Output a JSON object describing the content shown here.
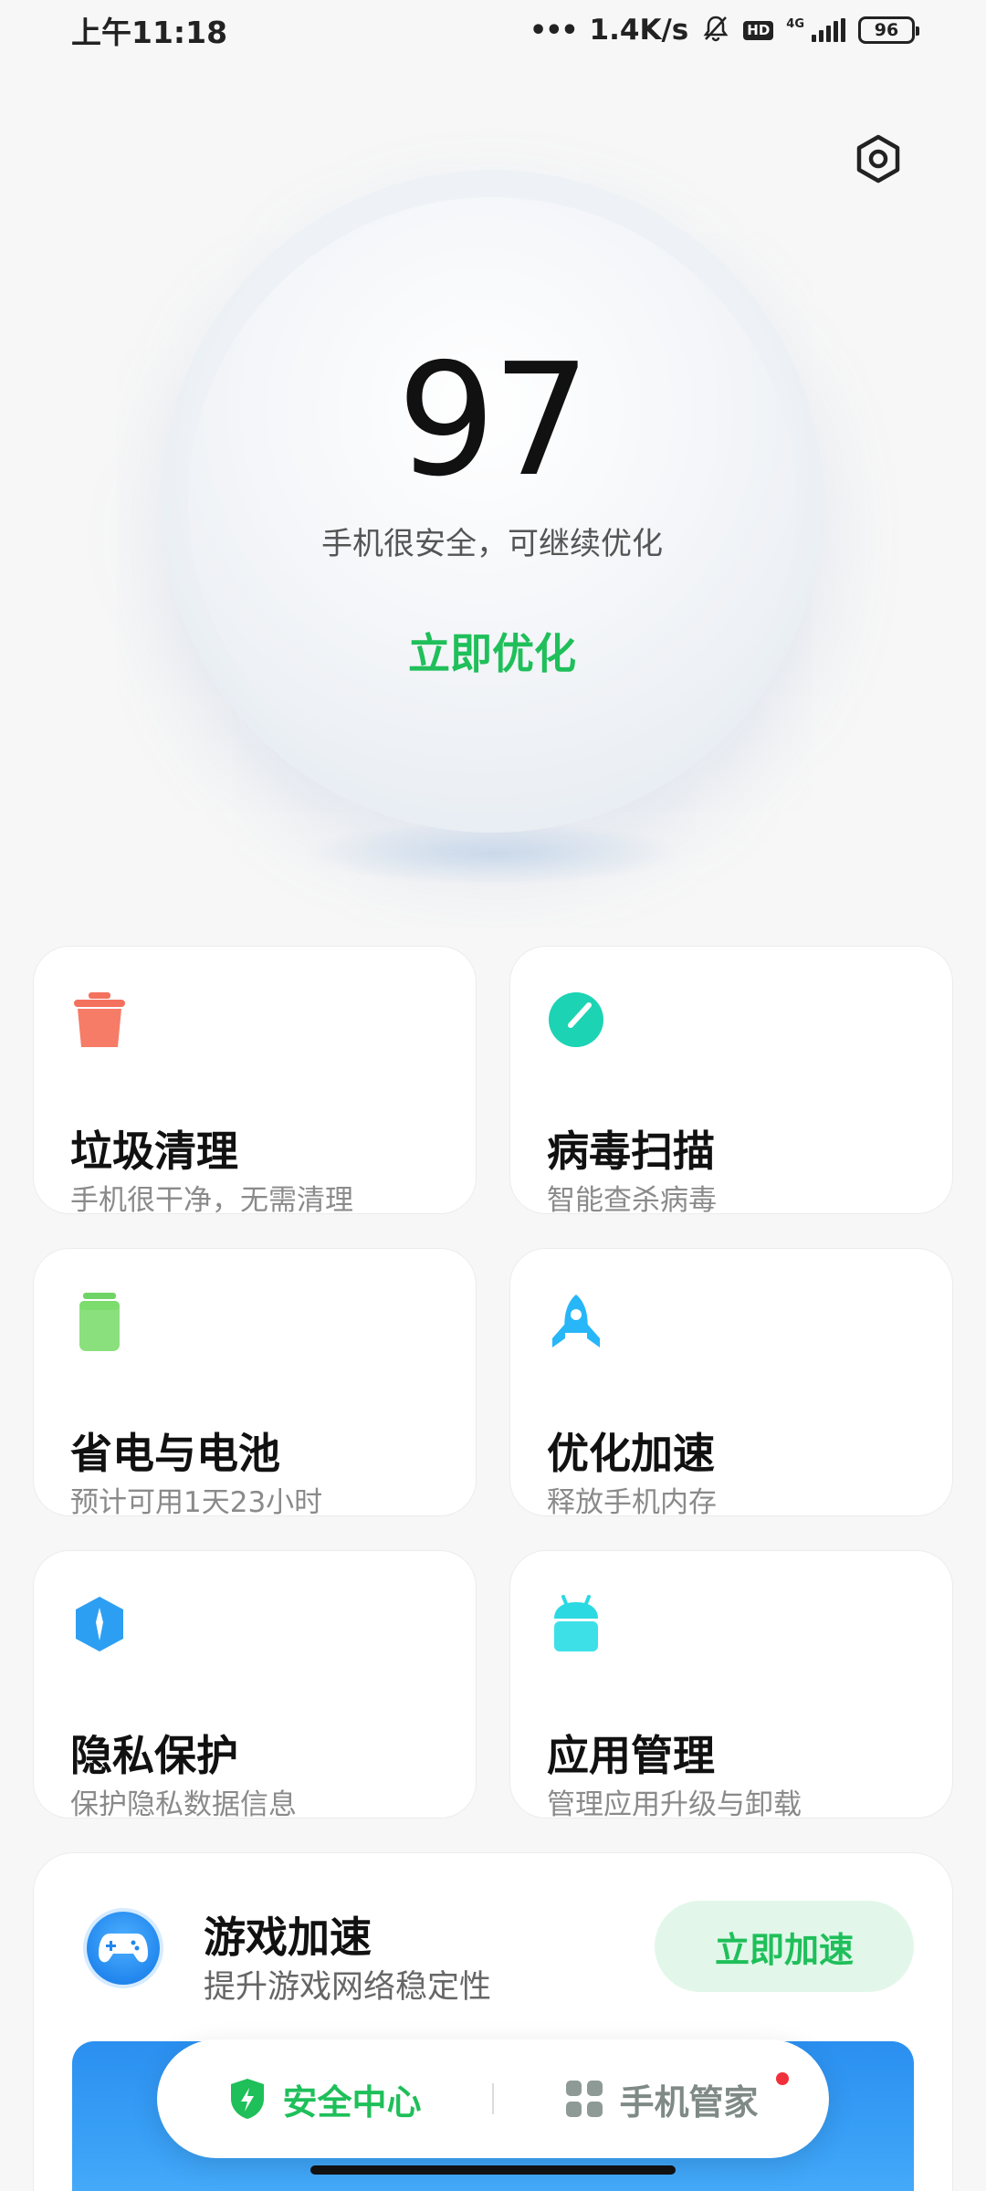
{
  "status_bar": {
    "time": "上午11:18",
    "network_speed": "1.4K/s",
    "hd_label": "HD",
    "network_type": "4G",
    "battery": "96"
  },
  "score": {
    "value": "97",
    "description": "手机很安全，可继续优化",
    "action_label": "立即优化"
  },
  "features": [
    {
      "title": "垃圾清理",
      "subtitle": "手机很干净，无需清理",
      "icon": "trash-icon",
      "color": "#f4715e"
    },
    {
      "title": "病毒扫描",
      "subtitle": "智能查杀病毒",
      "icon": "virus-scan-icon",
      "color": "#1cd3b4"
    },
    {
      "title": "省电与电池",
      "subtitle": "预计可用1天23小时",
      "icon": "battery-icon",
      "color": "#7ddc6e"
    },
    {
      "title": "优化加速",
      "subtitle": "释放手机内存",
      "icon": "rocket-icon",
      "color": "#27b6f8"
    },
    {
      "title": "隐私保护",
      "subtitle": "保护隐私数据信息",
      "icon": "privacy-shield-icon",
      "color": "#2d9ff3"
    },
    {
      "title": "应用管理",
      "subtitle": "管理应用升级与卸载",
      "icon": "android-app-icon",
      "color": "#2bd9e2"
    }
  ],
  "game_boost": {
    "title": "游戏加速",
    "subtitle": "提升游戏网络稳定性",
    "button_label": "立即加速",
    "icon": "gamepad-icon"
  },
  "bottom_nav": {
    "items": [
      {
        "label": "安全中心",
        "icon": "shield-bolt-icon",
        "active": true
      },
      {
        "label": "手机管家",
        "icon": "grid-apps-icon",
        "active": false,
        "badge": true
      }
    ]
  },
  "colors": {
    "accent_green": "#1fbf5a",
    "ring_blue": "#29b6f6"
  }
}
